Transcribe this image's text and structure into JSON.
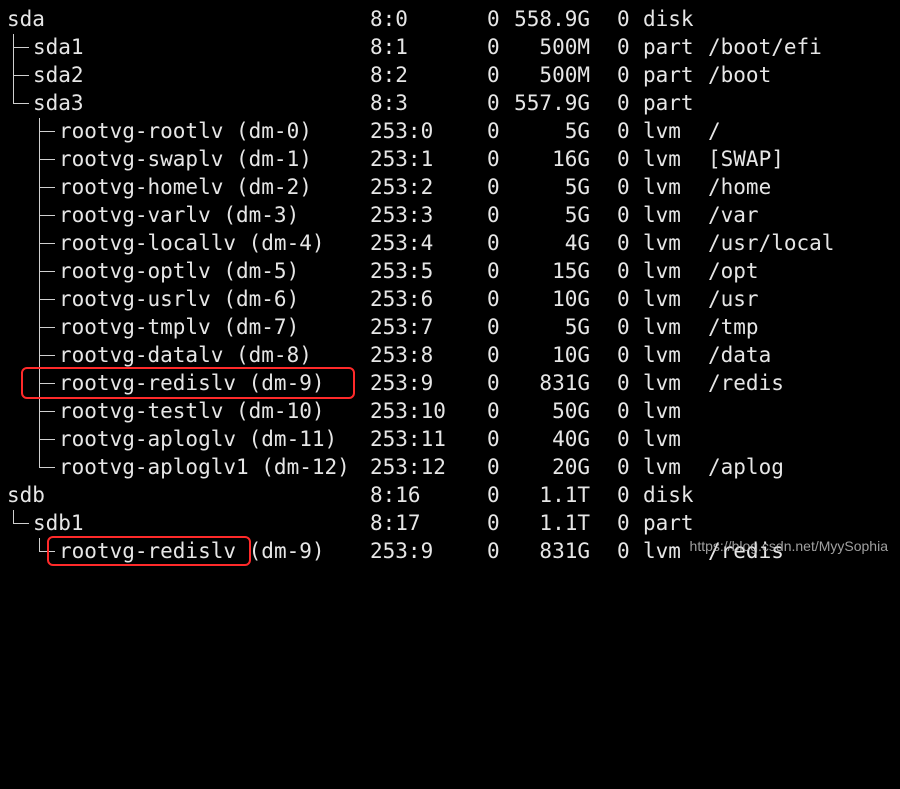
{
  "rows": [
    {
      "name": "sda",
      "majmin": "8:0",
      "rm": "0",
      "size": "558.9G",
      "ro": "0",
      "type": "disk",
      "mount": ""
    },
    {
      "name": "sda1",
      "majmin": "8:1",
      "rm": "0",
      "size": "500M",
      "ro": "0",
      "type": "part",
      "mount": "/boot/efi"
    },
    {
      "name": "sda2",
      "majmin": "8:2",
      "rm": "0",
      "size": "500M",
      "ro": "0",
      "type": "part",
      "mount": "/boot"
    },
    {
      "name": "sda3",
      "majmin": "8:3",
      "rm": "0",
      "size": "557.9G",
      "ro": "0",
      "type": "part",
      "mount": ""
    },
    {
      "name": "rootvg-rootlv (dm-0)",
      "majmin": "253:0",
      "rm": "0",
      "size": "5G",
      "ro": "0",
      "type": "lvm",
      "mount": "/"
    },
    {
      "name": "rootvg-swaplv (dm-1)",
      "majmin": "253:1",
      "rm": "0",
      "size": "16G",
      "ro": "0",
      "type": "lvm",
      "mount": "[SWAP]"
    },
    {
      "name": "rootvg-homelv (dm-2)",
      "majmin": "253:2",
      "rm": "0",
      "size": "5G",
      "ro": "0",
      "type": "lvm",
      "mount": "/home"
    },
    {
      "name": "rootvg-varlv (dm-3)",
      "majmin": "253:3",
      "rm": "0",
      "size": "5G",
      "ro": "0",
      "type": "lvm",
      "mount": "/var"
    },
    {
      "name": "rootvg-locallv (dm-4)",
      "majmin": "253:4",
      "rm": "0",
      "size": "4G",
      "ro": "0",
      "type": "lvm",
      "mount": "/usr/local"
    },
    {
      "name": "rootvg-optlv (dm-5)",
      "majmin": "253:5",
      "rm": "0",
      "size": "15G",
      "ro": "0",
      "type": "lvm",
      "mount": "/opt"
    },
    {
      "name": "rootvg-usrlv (dm-6)",
      "majmin": "253:6",
      "rm": "0",
      "size": "10G",
      "ro": "0",
      "type": "lvm",
      "mount": "/usr"
    },
    {
      "name": "rootvg-tmplv (dm-7)",
      "majmin": "253:7",
      "rm": "0",
      "size": "5G",
      "ro": "0",
      "type": "lvm",
      "mount": "/tmp"
    },
    {
      "name": "rootvg-datalv (dm-8)",
      "majmin": "253:8",
      "rm": "0",
      "size": "10G",
      "ro": "0",
      "type": "lvm",
      "mount": "/data"
    },
    {
      "name": "rootvg-redislv (dm-9)",
      "majmin": "253:9",
      "rm": "0",
      "size": "831G",
      "ro": "0",
      "type": "lvm",
      "mount": "/redis"
    },
    {
      "name": "rootvg-testlv (dm-10)",
      "majmin": "253:10",
      "rm": "0",
      "size": "50G",
      "ro": "0",
      "type": "lvm",
      "mount": ""
    },
    {
      "name": "rootvg-aploglv (dm-11)",
      "majmin": "253:11",
      "rm": "0",
      "size": "40G",
      "ro": "0",
      "type": "lvm",
      "mount": ""
    },
    {
      "name": "rootvg-aploglv1 (dm-12)",
      "majmin": "253:12",
      "rm": "0",
      "size": "20G",
      "ro": "0",
      "type": "lvm",
      "mount": "/aplog"
    },
    {
      "name": "sdb",
      "majmin": "8:16",
      "rm": "0",
      "size": "1.1T",
      "ro": "0",
      "type": "disk",
      "mount": ""
    },
    {
      "name": "sdb1",
      "majmin": "8:17",
      "rm": "0",
      "size": "1.1T",
      "ro": "0",
      "type": "part",
      "mount": ""
    },
    {
      "name": "rootvg-redislv",
      "suffix": " (dm-9)",
      "majmin": "253:9",
      "rm": "0",
      "size": "831G",
      "ro": "0",
      "type": "lvm",
      "mount": "/redis"
    }
  ],
  "watermark": "https://blog.csdn.net/MyySophia",
  "colors": {
    "background": "#000000",
    "text": "#e6e6e6",
    "highlight": "#ff2a2a"
  }
}
